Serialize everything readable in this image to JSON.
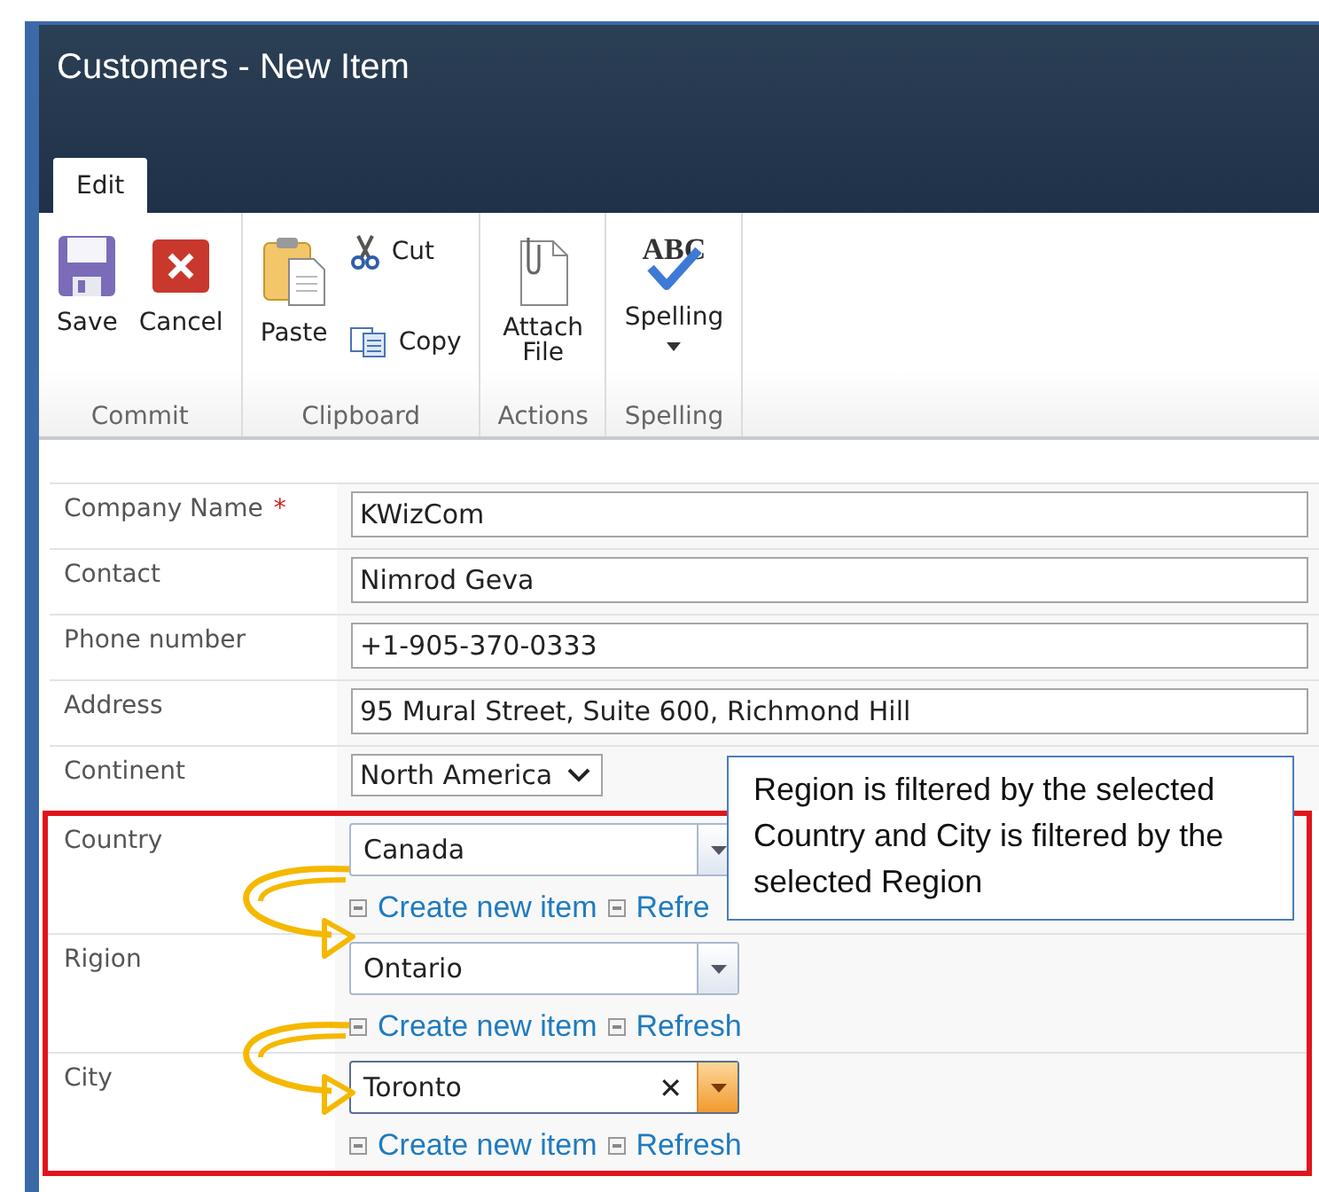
{
  "window": {
    "title": "Customers - New Item"
  },
  "tabs": [
    {
      "label": "Edit",
      "selected": true
    }
  ],
  "ribbon": {
    "groups": [
      {
        "label": "Commit",
        "buttons": [
          {
            "kind": "save",
            "label": "Save"
          },
          {
            "kind": "cancel",
            "label": "Cancel"
          }
        ]
      },
      {
        "label": "Clipboard",
        "buttons": [
          {
            "kind": "paste",
            "label": "Paste"
          },
          {
            "kind": "cut",
            "label": "Cut"
          },
          {
            "kind": "copy",
            "label": "Copy"
          }
        ]
      },
      {
        "label": "Actions",
        "buttons": [
          {
            "kind": "attach",
            "label": "Attach File"
          }
        ]
      },
      {
        "label": "Spelling",
        "buttons": [
          {
            "kind": "spelling",
            "label": "Spelling",
            "icon_text": "ABC"
          }
        ]
      }
    ]
  },
  "fields": [
    {
      "kind": "text",
      "label": "Company Name",
      "required_mark": "*",
      "value": "KWizCom"
    },
    {
      "kind": "text",
      "label": "Contact",
      "value": "Nimrod Geva"
    },
    {
      "kind": "text",
      "label": "Phone number",
      "value": "+1-905-370-0333"
    },
    {
      "kind": "text",
      "label": "Address",
      "value": "95 Mural Street, Suite 600, Richmond Hill"
    },
    {
      "kind": "select",
      "label": "Continent",
      "value": "North America"
    }
  ],
  "filtered_fields": [
    {
      "label": "Country",
      "value": "Canada",
      "active": false,
      "links": [
        "Create new item",
        "Refre"
      ]
    },
    {
      "label": "Rigion",
      "value": "Ontario",
      "active": false,
      "links": [
        "Create new item",
        "Refresh"
      ]
    },
    {
      "label": "City",
      "value": "Toronto",
      "clear_icon": "✕",
      "active": true,
      "links": [
        "Create new item",
        "Refresh"
      ]
    }
  ],
  "callout": {
    "text": "Region is filtered by the selected Country and City is filtered by the selected Region"
  }
}
